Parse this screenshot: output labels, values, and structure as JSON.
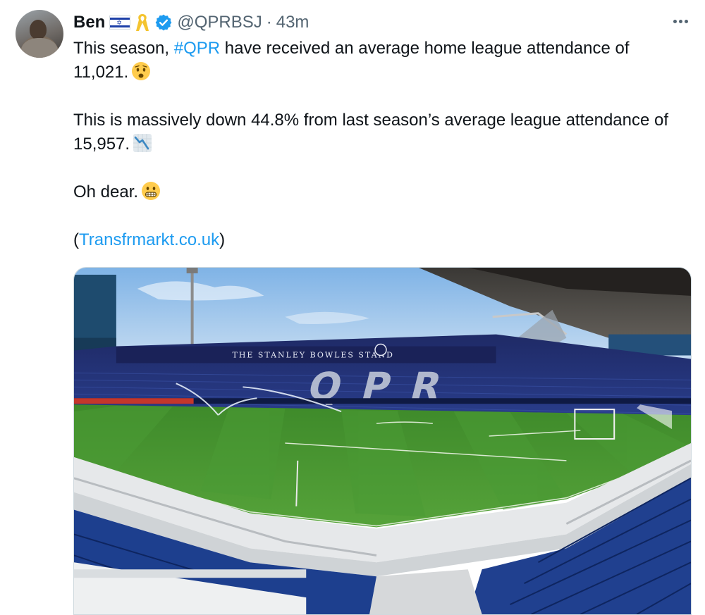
{
  "author": {
    "name": "Ben",
    "handle": "@QPRBSJ",
    "separator": "·",
    "time": "43m"
  },
  "tweet": {
    "line1_pre": "This season, ",
    "hashtag": "#QPR",
    "line1_post": " have received an average home league attendance of 11,021.",
    "line2": "This is massively down 44.8% from last season’s average league attendance of 15,957.",
    "line3": "Oh dear.",
    "source_open": "(",
    "source_link": "Transfrmarkt.co.uk",
    "source_close": ")"
  },
  "media": {
    "stand_sign": "THE STANLEY  BOWLES STAND",
    "seat_letters": "QPR"
  },
  "icons": {
    "flag": "israel-flag-icon",
    "ribbon": "yellow-ribbon-icon",
    "verified": "verified-badge-icon",
    "more": "more-options-icon",
    "emoji_worried": "worried-face-emoji",
    "emoji_chart": "chart-decreasing-emoji",
    "emoji_grimace": "grimacing-face-emoji"
  },
  "colors": {
    "link": "#1d9bf0",
    "verified": "#1d9bf0",
    "text": "#0f1419",
    "muted": "#536471"
  }
}
